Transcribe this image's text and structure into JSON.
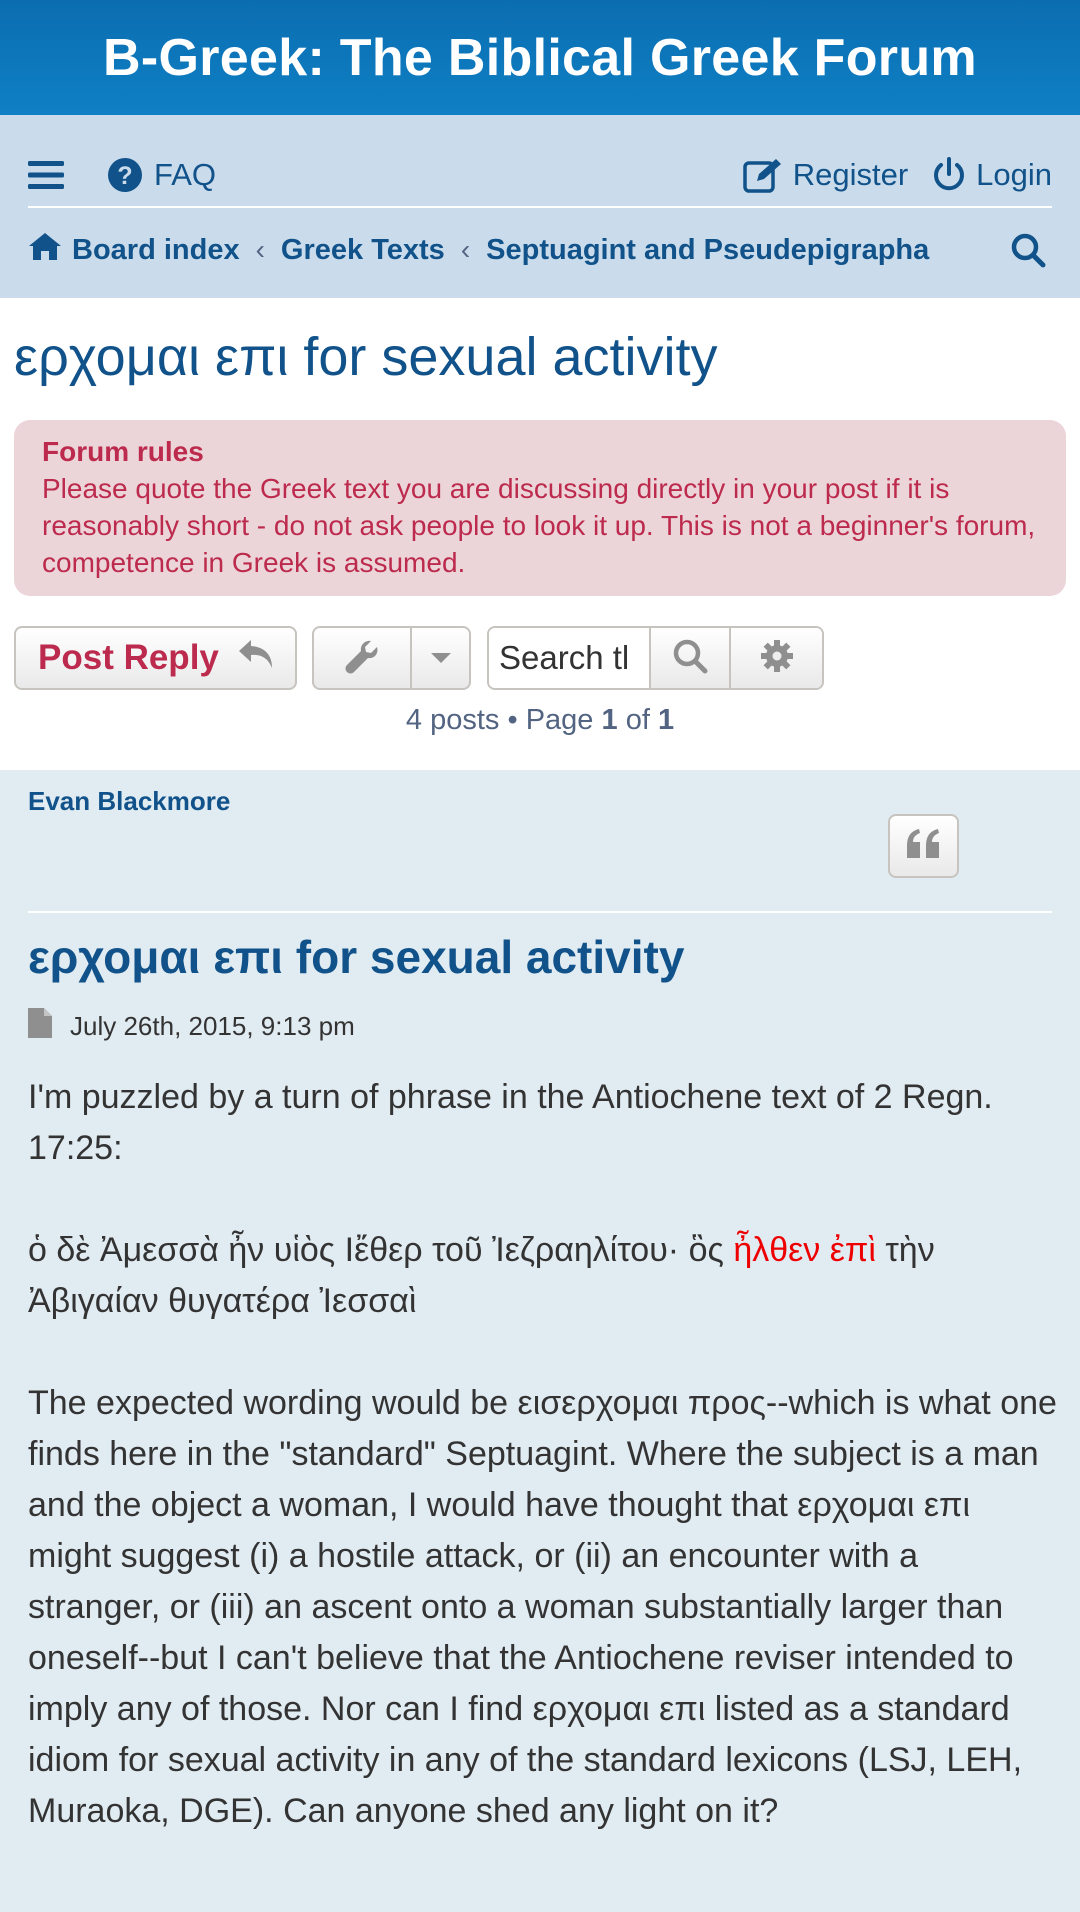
{
  "site": {
    "title": "B-Greek: The Biblical Greek Forum"
  },
  "nav": {
    "menu_icon": "hamburger-icon",
    "faq_label": "FAQ",
    "register_label": "Register",
    "login_label": "Login"
  },
  "breadcrumbs": [
    {
      "label": "Board index"
    },
    {
      "label": "Greek Texts"
    },
    {
      "label": "Septuagint and Pseudepigrapha"
    }
  ],
  "breadcrumb_separator": "‹",
  "topic": {
    "title": "ερχομαι επι for sexual activity"
  },
  "rules": {
    "title": "Forum rules",
    "text": "Please quote the Greek text you are discussing directly in your post if it is reasonably short - do not ask people to look it up. This is not a beginner's forum, competence in Greek is assumed."
  },
  "actions": {
    "post_reply_label": "Post Reply",
    "search_placeholder": "Search this topic…",
    "search_value": "Search tl"
  },
  "pagination": {
    "prefix": "4 posts • Page",
    "current": "1",
    "of": "of",
    "total": "1"
  },
  "post": {
    "author": "Evan Blackmore",
    "title": "ερχομαι επι for sexual activity",
    "date": "July 26th, 2015, 9:13 pm",
    "para1": "I'm puzzled by a turn of phrase in the Antiochene text of 2 Regn. 17:25:",
    "greek_before": "ὁ δὲ Ἀμεσσὰ ἦν υἱὸς Ιἔθερ τοῦ Ἰεζραηλίτου· ὃς ",
    "greek_highlight": "ἦλθεν ἐπὶ",
    "greek_after": " τὴν Ἀβιγαίαν θυγατέρα Ἰεσσαὶ",
    "para3": "The expected wording would be εισερχομαι προς--which is what one finds here in the \"standard\" Septuagint. Where the subject is a man and the object a woman, I would have thought that ερχομαι επι might suggest (i) a hostile attack, or (ii) an encounter with a stranger, or (iii) an ascent onto a woman substantially larger than oneself--but I can't believe that the Antiochene reviser intended to imply any of those. Nor can I find ερχομαι επι listed as a standard idiom for sexual activity in any of the standard lexicons (LSJ, LEH, Muraoka, DGE). Can anyone shed any light on it?"
  },
  "colors": {
    "header_blue": "#0f80c5",
    "link_blue": "#105289",
    "nav_bg": "#cadceb",
    "rules_bg": "#ecd5d8",
    "rules_text": "#bc2a4d",
    "post_bg": "#e1ebf2",
    "highlight_red": "#ee0000"
  }
}
